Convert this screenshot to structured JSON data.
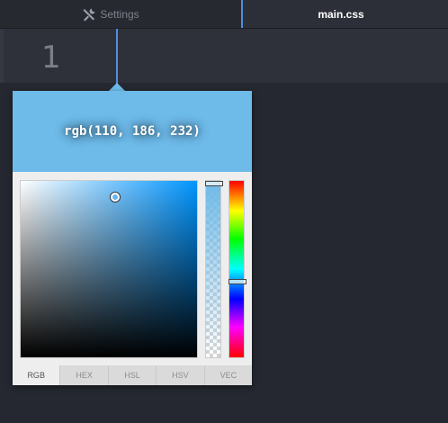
{
  "tabs": {
    "settings": {
      "label": "Settings",
      "icon": "tools-icon"
    },
    "main": {
      "label": "main.css",
      "active": true
    }
  },
  "editor": {
    "line_number": "1"
  },
  "color_picker": {
    "preview_text": "rgb(110, 186, 232)",
    "color": "#6ebae8",
    "hue_color": "#0095ff",
    "saturation": 0.53,
    "value": 0.91,
    "hue_level": 0.57,
    "alpha_level": 0.0,
    "modes": [
      {
        "label": "RGB",
        "active": true
      },
      {
        "label": "HEX",
        "active": false
      },
      {
        "label": "HSL",
        "active": false
      },
      {
        "label": "HSV",
        "active": false
      },
      {
        "label": "VEC",
        "active": false
      }
    ]
  }
}
